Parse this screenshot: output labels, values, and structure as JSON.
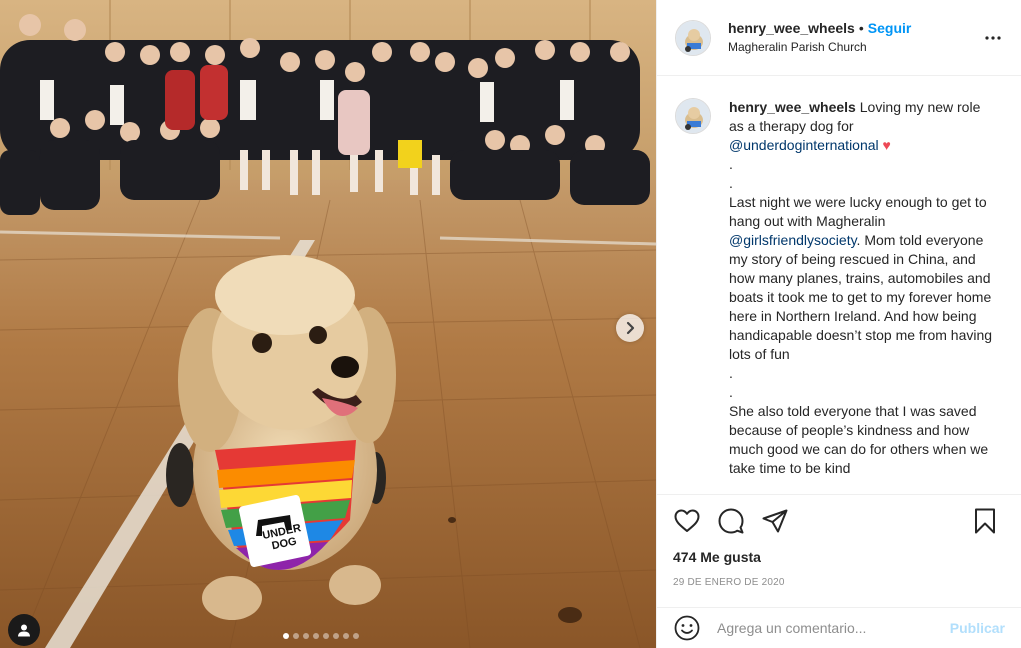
{
  "post": {
    "username": "henry_wee_wheels",
    "separator": "•",
    "follow_label": "Seguir",
    "location": "Magheralin Parish Church",
    "more_icon": "more-horizontal-icon"
  },
  "caption": {
    "username": "henry_wee_wheels",
    "line1": "Loving my new role as a therapy dog for",
    "mention1": "@underdoginternational",
    "heart": "♥",
    "dots1": ".\n.",
    "line2": "Last night we were lucky enough to get to hang out with Magheralin",
    "mention2": "@girlsfriendlysociety",
    "line3": ". Mom told everyone my story of being rescued in China, and how many planes, trains, automobiles and boats it took me to get to my forever home here in Northern Ireland. And how being handicapable doesn’t stop me from having lots of fun",
    "dots2": ".\n.",
    "line4": "She also told everyone that I was saved because of people’s kindness and how much good we can do for others when we take time to be kind"
  },
  "photo": {
    "bandana_text_1": "UNDER",
    "bandana_text_2": "DOG",
    "carousel": {
      "count": 8,
      "active": 0
    }
  },
  "actions": {
    "likes": "474 Me gusta",
    "date": "29 DE ENERO DE 2020"
  },
  "comment_box": {
    "placeholder": "Agrega un comentario...",
    "publish_label": "Publicar"
  },
  "colors": {
    "follow": "#0095f6",
    "mention": "#00376b",
    "publish_disabled": "#b2dffc",
    "heart": "#ed4956"
  }
}
